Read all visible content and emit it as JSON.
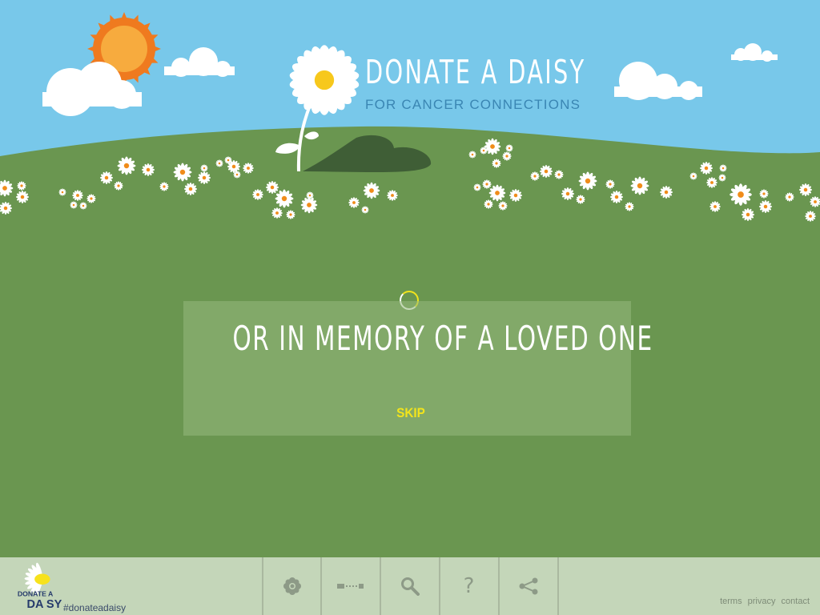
{
  "brand": {
    "title": "DONATE A DAISY",
    "subtitle": "FOR CANCER CONNECTIONS"
  },
  "modal": {
    "heading": "OR IN MEMORY OF A LOVED ONE",
    "skip_label": "SKIP"
  },
  "footer": {
    "logo_text_top": "DONATE A",
    "logo_text_bottom": "DA SY",
    "hashtag": "#donateadaisy",
    "nav": [
      {
        "icon": "daisy-icon"
      },
      {
        "icon": "timeline-icon"
      },
      {
        "icon": "search-icon"
      },
      {
        "icon": "help-icon",
        "label": "?"
      },
      {
        "icon": "share-icon"
      }
    ],
    "links": {
      "terms": "terms",
      "privacy": "privacy",
      "contact": "contact"
    }
  },
  "colors": {
    "sky": "#78c8ea",
    "grass": "#6a9650",
    "accent_yellow": "#f2e41c",
    "footer_bg": "#c4d6b9"
  }
}
